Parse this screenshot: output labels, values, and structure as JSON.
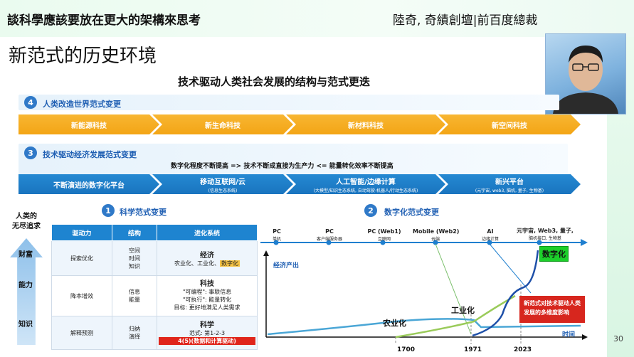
{
  "header": {
    "title": "談科學應該要放在更大的架構來思考",
    "author": "陸奇, 奇績創壇|前百度總裁"
  },
  "slide": {
    "title": "新范式的历史环境",
    "diagram_title": "技术驱动人类社会发展的结构与范式更迭",
    "page_number": "30"
  },
  "section4": {
    "number": "4",
    "title": "人类改造世界范式变更",
    "chevrons": [
      {
        "label": "新能源科技"
      },
      {
        "label": "新生命科技"
      },
      {
        "label": "新材料科技"
      },
      {
        "label": "新空间科技"
      }
    ]
  },
  "section3": {
    "number": "3",
    "title": "技术驱动经济发展范式变更",
    "note": "数字化程度不断提高 => 技术不断成直接为生产力  <= 能量转化效率不断提高",
    "chevrons": [
      {
        "label": "不断演进的数字化平台",
        "sub": ""
      },
      {
        "label": "移动互联网/云",
        "sub": "(信息生态系统)"
      },
      {
        "label": "人工智能/边缘计算",
        "sub": "(大模型/知识生态系统, 自动驾驶-机器人/行动生态系统)"
      },
      {
        "label": "新兴平台",
        "sub": "(元宇宙, web3, 脑机, 量子, 生物基)"
      }
    ]
  },
  "section1": {
    "number": "1",
    "title": "科学范式变更"
  },
  "section2": {
    "number": "2",
    "title": "数字化范式变更"
  },
  "side": {
    "title_line1": "人类的",
    "title_line2": "无尽追求",
    "word1": "财富",
    "word2": "能力",
    "word3": "知识"
  },
  "table": {
    "headers": [
      "驱动力",
      "结构",
      "进化系统"
    ],
    "rows": [
      {
        "driver": "探索优化",
        "structure": [
          "空间",
          "时间",
          "知识"
        ],
        "evo_main": "经济",
        "evo_line": "农业化、工业化、",
        "evo_highlight": "数字化"
      },
      {
        "driver": "降本增效",
        "structure": [
          "信息",
          "能量"
        ],
        "evo_main": "科技",
        "evo_lines": [
          "\"可编程\": 事联信息",
          "\"可执行\": 能量转化",
          "目标: 更好地满足人类需求"
        ]
      },
      {
        "driver": "解释预测",
        "structure": [
          "归纳",
          "演绎"
        ],
        "evo_main": "科学",
        "evo_line": "范式: 第1-2-3",
        "evo_highlight": "4(5)(数据和计算驱动)"
      }
    ]
  },
  "chart_data": {
    "type": "line",
    "title": "",
    "xlabel": "时间",
    "ylabel": "经济产出",
    "eras": [
      {
        "name": "PC",
        "sub": "单机"
      },
      {
        "name": "PC",
        "sub": "客户端服务器"
      },
      {
        "name": "PC (Web1)",
        "sub": "互联网"
      },
      {
        "name": "Mobile (Web2)",
        "sub": "云端"
      },
      {
        "name": "AI",
        "sub": "边缘计算"
      },
      {
        "name": "元宇宙, Web3, 量子,",
        "sub": "脑机接口, 生物基"
      }
    ],
    "x_ticks": [
      "1700",
      "1971",
      "2023"
    ],
    "series": [
      {
        "name": "农业化"
      },
      {
        "name": "工业化"
      },
      {
        "name": "数字化"
      }
    ],
    "annotation": "新范式对技术驱动人类发展的多维度影响"
  },
  "colors": {
    "orange": "#f3a516",
    "blue": "#1974bf",
    "accent_red": "#d7261e",
    "accent_green": "#1ccf2a"
  }
}
